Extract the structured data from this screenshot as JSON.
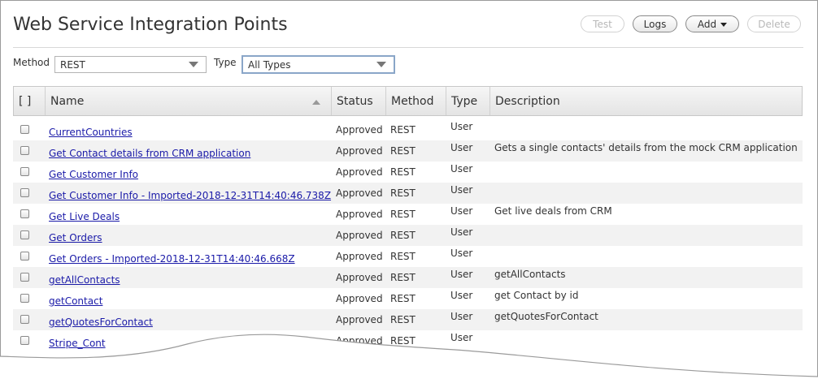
{
  "page": {
    "title": "Web Service Integration Points"
  },
  "toolbar": {
    "test": "Test",
    "logs": "Logs",
    "add": "Add",
    "delete": "Delete"
  },
  "filters": {
    "method_label": "Method",
    "method_value": "REST",
    "type_label": "Type",
    "type_value": "All Types"
  },
  "table": {
    "headers": {
      "select": "[ ]",
      "name": "Name",
      "status": "Status",
      "method": "Method",
      "type": "Type",
      "description": "Description"
    },
    "rows": [
      {
        "name": "CurrentCountries",
        "status": "Approved",
        "method": "REST",
        "type": "User",
        "description": ""
      },
      {
        "name": "Get Contact details from CRM application",
        "status": "Approved",
        "method": "REST",
        "type": "User",
        "description": "Gets a single contacts' details from the mock CRM application"
      },
      {
        "name": "Get Customer Info",
        "status": "Approved",
        "method": "REST",
        "type": "User",
        "description": ""
      },
      {
        "name": "Get Customer Info - Imported-2018-12-31T14:40:46.738Z",
        "status": "Approved",
        "method": "REST",
        "type": "User",
        "description": ""
      },
      {
        "name": "Get Live Deals",
        "status": "Approved",
        "method": "REST",
        "type": "User",
        "description": "Get live deals from CRM"
      },
      {
        "name": "Get Orders",
        "status": "Approved",
        "method": "REST",
        "type": "User",
        "description": ""
      },
      {
        "name": "Get Orders - Imported-2018-12-31T14:40:46.668Z",
        "status": "Approved",
        "method": "REST",
        "type": "User",
        "description": ""
      },
      {
        "name": "getAllContacts",
        "status": "Approved",
        "method": "REST",
        "type": "User",
        "description": "getAllContacts"
      },
      {
        "name": "getContact",
        "status": "Approved",
        "method": "REST",
        "type": "User",
        "description": "get Contact by id"
      },
      {
        "name": "getQuotesForContact",
        "status": "Approved",
        "method": "REST",
        "type": "User",
        "description": "getQuotesForContact"
      },
      {
        "name": "Stripe_Cont",
        "status": "Approved",
        "method": "REST",
        "type": "User",
        "description": ""
      }
    ]
  }
}
